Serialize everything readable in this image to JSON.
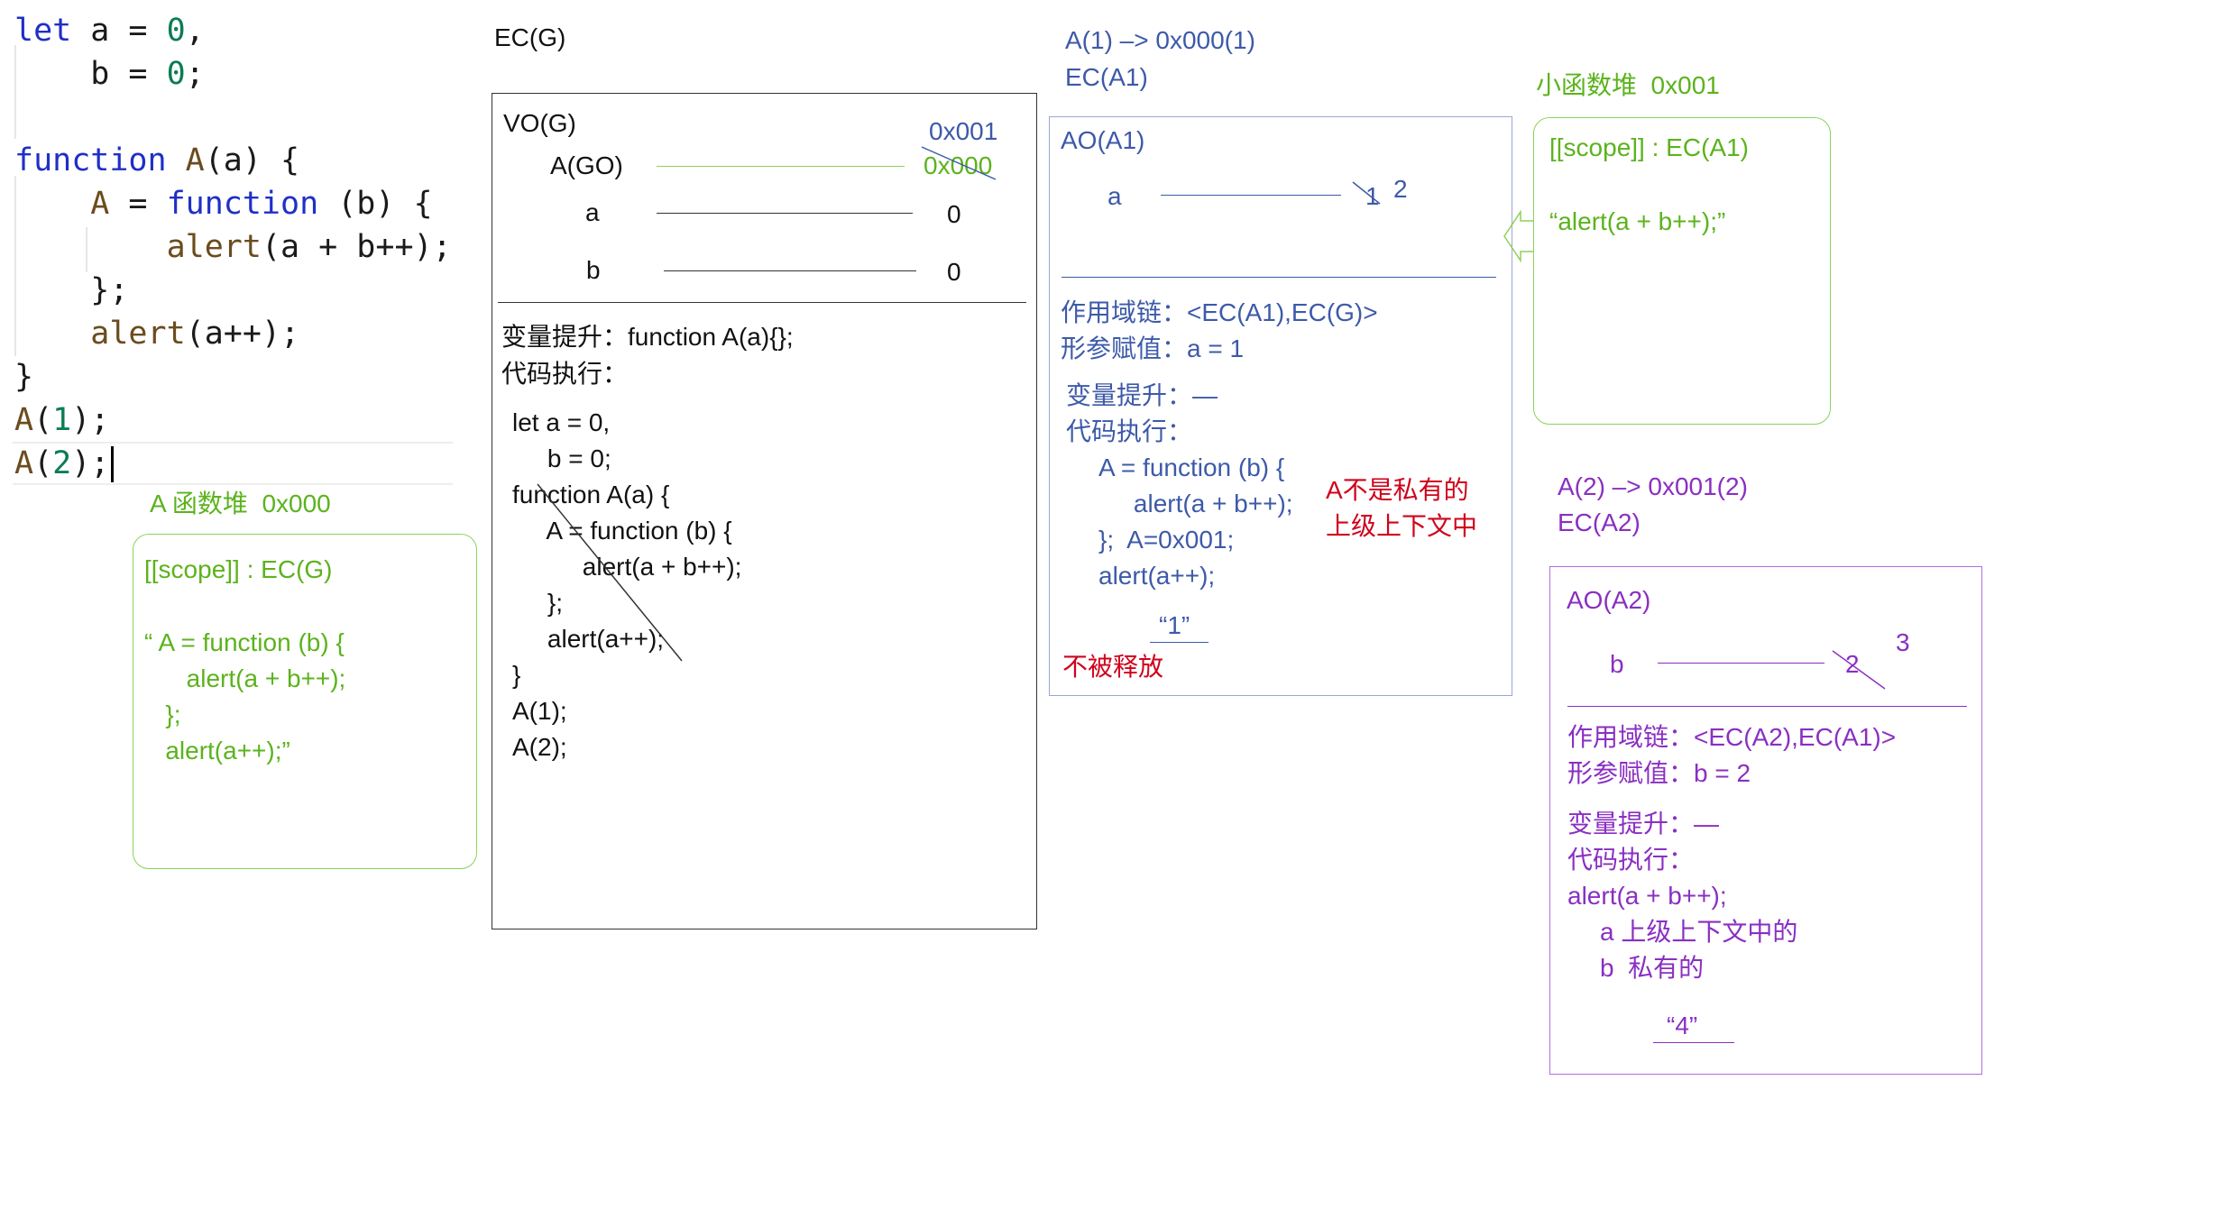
{
  "colors": {
    "black": "#111111",
    "green": "#5cb31d",
    "blue": "#3d5aa9",
    "purple": "#8a2fc2",
    "red": "#d0021b",
    "keyword": "#1f2fc7",
    "number": "#0a7d52"
  },
  "code_editor": {
    "line1": {
      "kw": "let",
      "rest": " a = ",
      "num": "0",
      "end": ","
    },
    "line2": {
      "rest": "    b = ",
      "num": "0",
      "end": ";"
    },
    "line3": "",
    "line4": {
      "kw": "function",
      "fn": " A",
      "rest": "(a) {"
    },
    "line5": {
      "fn": "    A",
      "rest": " = ",
      "kw": "function",
      "end": " (b) {"
    },
    "line6": {
      "fn": "        alert",
      "rest": "(a + b++);"
    },
    "line7": "    };",
    "line8": {
      "fn": "    alert",
      "rest": "(a++);"
    },
    "line9": "}",
    "line10": {
      "fn": "A",
      "open": "(",
      "num": "1",
      "end": ");"
    },
    "line11": {
      "fn": "A",
      "open": "(",
      "num": "2",
      "end": ");"
    }
  },
  "heap_a": {
    "title": "A 函数堆  0x000",
    "scope": "[[scope]] : EC(G)",
    "code_lines": [
      "“ A = function (b) {",
      "      alert(a + b++);",
      "   };",
      "   alert(a++);”"
    ]
  },
  "ec_g": {
    "title": "EC(G)",
    "vo_title": "VO(G)",
    "vars": [
      {
        "name": "A(GO)",
        "value_new": "0x001",
        "value_old": "0x000"
      },
      {
        "name": "a",
        "value": "0"
      },
      {
        "name": "b",
        "value": "0"
      }
    ],
    "hoisting": "变量提升：function A(a){};",
    "execution": "代码执行：",
    "code_lines": [
      "let a = 0,",
      "     b = 0;",
      "function A(a) {",
      "     A = function (b) {",
      "          alert(a + b++);",
      "     };",
      "     alert(a++);",
      "}",
      "A(1);",
      "A(2);"
    ]
  },
  "ec_a1": {
    "header1": "A(1) –> 0x000(1)",
    "header2": "EC(A1)",
    "ao_title": "AO(A1)",
    "var_name": "a",
    "value_old": "1",
    "value_new": "2",
    "scope_chain": "作用域链：<EC(A1),EC(G)>",
    "param_assign": "形参赋值：a = 1",
    "hoisting": "变量提升：—",
    "execution": "代码执行：",
    "code_lines": [
      "A = function (b) {",
      "     alert(a + b++);",
      "};  A=0x001;",
      "alert(a++);"
    ],
    "output": "“1”",
    "note_line1": "A不是私有的",
    "note_line2": "上级上下文中",
    "not_released": "不被释放"
  },
  "heap_small": {
    "title": "小函数堆  0x001",
    "scope": "[[scope]] : EC(A1)",
    "code": "“alert(a + b++);”"
  },
  "ec_a2": {
    "header1": "A(2) –> 0x001(2)",
    "header2": "EC(A2)",
    "ao_title": "AO(A2)",
    "var_name": "b",
    "value_old": "2",
    "value_new": "3",
    "scope_chain": "作用域链：<EC(A2),EC(A1)>",
    "param_assign": "形参赋值：b = 2",
    "hoisting": "变量提升：—",
    "execution": "代码执行：",
    "code_line": "alert(a + b++);",
    "note_a": "a 上级上下文中的",
    "note_b": "b  私有的",
    "output": "“4”"
  }
}
